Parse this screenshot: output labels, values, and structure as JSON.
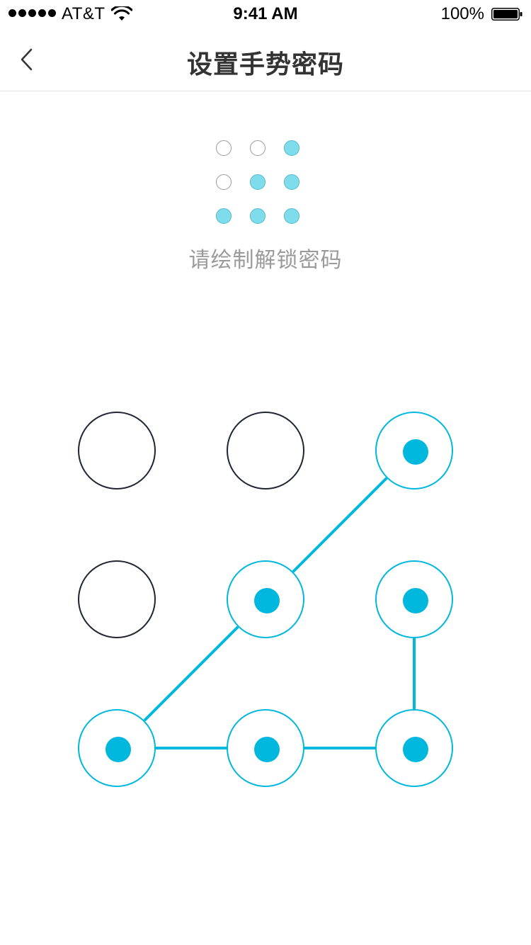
{
  "status_bar": {
    "carrier": "AT&T",
    "time": "9:41 AM",
    "battery_percent": "100%",
    "signal_bars": 5,
    "wifi_icon": "wifi-icon",
    "battery_icon": "battery-full-icon"
  },
  "nav": {
    "back_icon": "chevron-left-icon",
    "title": "设置手势密码"
  },
  "preview": {
    "selected": [
      false,
      false,
      true,
      false,
      true,
      true,
      true,
      true,
      true
    ]
  },
  "hint": "请绘制解锁密码",
  "pattern": {
    "selected": [
      false,
      false,
      true,
      false,
      true,
      true,
      true,
      true,
      true
    ],
    "path": [
      2,
      4,
      6,
      7,
      8,
      5
    ]
  },
  "colors": {
    "accent": "#00b7dd",
    "preview_on": "#7fdcea",
    "node_off_border": "#1f2533",
    "hint": "#9a9a9a"
  }
}
